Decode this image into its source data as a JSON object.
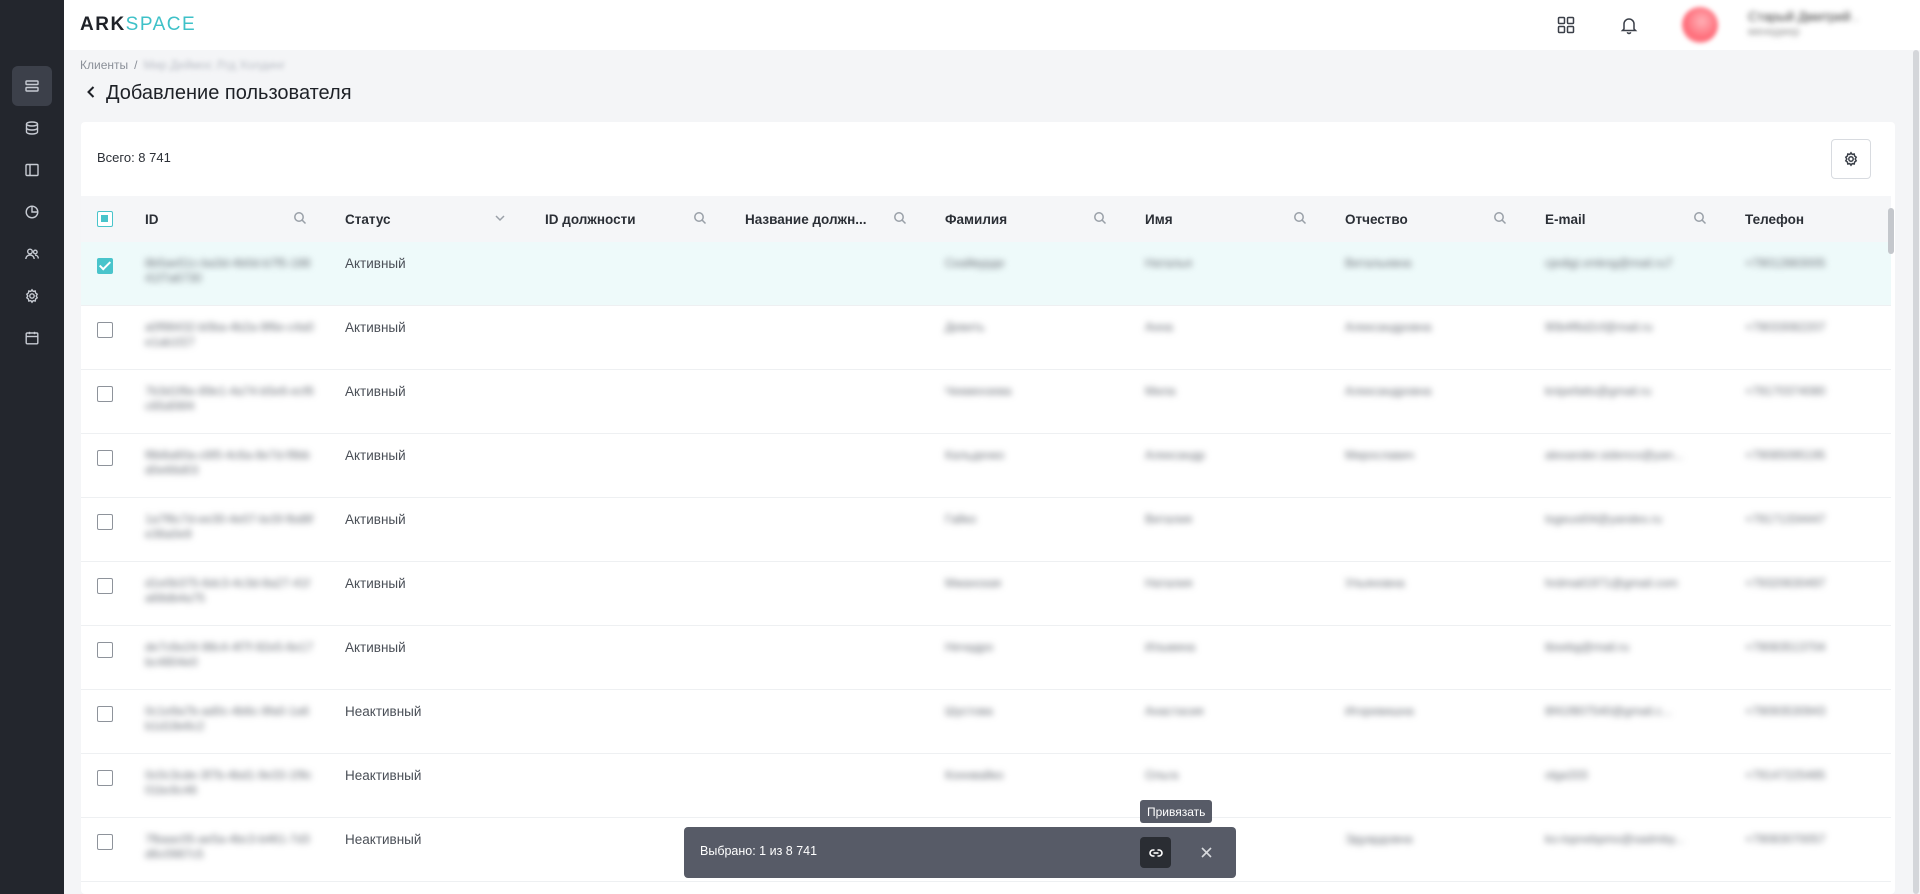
{
  "app": {
    "logo_part1": "ARK",
    "logo_part2": "SPACE"
  },
  "user": {
    "name": "Старый Дмитрий .",
    "role": "менеджер"
  },
  "breadcrumb": {
    "root": "Клиенты",
    "separator": "/",
    "current": "Мир Деймос Лтд Холдинг"
  },
  "page": {
    "title": "Добавление пользователя",
    "total": "Всего: 8 741"
  },
  "table": {
    "columns": [
      "ID",
      "Статус",
      "ID должности",
      "Название должн...",
      "Фамилия",
      "Имя",
      "Отчество",
      "E-mail",
      "Телефон"
    ],
    "rows": [
      {
        "id": "8b5ae51c-ba3d-4b0d-b7f5-18841f7a6730",
        "status": "Активный",
        "last": "Скайвурде",
        "first": "Наталья",
        "middle": "Витальевна",
        "email": "cjedigi.vmkng@mail.ru7",
        "phone": "+79012883005",
        "selected": true
      },
      {
        "id": "a0f98432-b0ba-4b2a-9f6e-c4a0e1ab1f27",
        "status": "Активный",
        "last": "Девить",
        "first": "Анна",
        "middle": "Александровна",
        "email": "90b4f6d2cf@mail.ru",
        "phone": "+79033082207",
        "selected": false
      },
      {
        "id": "7b3d1f6e-89e1-4a74-b5e6-ecf6c65d06f4",
        "status": "Активный",
        "last": "Чекмензева",
        "first": "Мила",
        "middle": "Александровна",
        "email": "knipefatts@gmail.ru",
        "phone": "+79170374080",
        "selected": false
      },
      {
        "id": "f8b8a60a-c6f0-4c6a-8e7d-f9bbd0e66d03",
        "status": "Активный",
        "last": "Кальденко",
        "first": "Александр",
        "middle": "Мирославич",
        "email": "alexander.sidenco@yan...",
        "phone": "+79085095195",
        "selected": false
      },
      {
        "id": "1a7f6c7d-ee30-4e07-bc5f-fbd8fe36a0e9",
        "status": "Активный",
        "last": "Гайко",
        "first": "Виталия",
        "middle": "",
        "email": "tsgeust04@yandex.ru",
        "phone": "+79171334447",
        "selected": false
      },
      {
        "id": "d1e0b375-6dc3-4c3d-8a27-41fa68db4a75",
        "status": "Активный",
        "last": "Мжанская",
        "first": "Наталия",
        "middle": "Ульяновна",
        "email": "hrdmail1971@gmail.com",
        "phone": "+79320630497",
        "selected": false
      },
      {
        "id": "de7c6e24-98c4-4f7f-92e5-6e17bc4804e0",
        "status": "Активный",
        "last": "Нечадро",
        "first": "Ильмина",
        "middle": "",
        "email": "tbsebg@mail.ru",
        "phone": "+79083513704",
        "selected": false
      },
      {
        "id": "0c1e9a7b-ad0c-4b6c-9fa0-1a6b1d18e6c2",
        "status": "Неактивный",
        "last": "Шустова",
        "first": "Анастасия",
        "middle": "Игоревишна",
        "email": "8f41f807540@gmail.c...",
        "phone": "+79093530943",
        "selected": false
      },
      {
        "id": "0c0c3cde-3f7b-4bd1-9e33-1f9c01bc6c46",
        "status": "Неактивный",
        "last": "Коннвайко",
        "first": "Ольга",
        "middle": "",
        "email": "olga333",
        "phone": "+79147225485",
        "selected": false
      },
      {
        "id": "7fbaac05-ae5a-4bc3-b461-7d3d6c0987c5",
        "status": "Неактивный",
        "last": "",
        "first": "",
        "middle": "Эдуардовна",
        "email": "ko-lopnebpmo@sadmby...",
        "phone": "+79083070057",
        "selected": false
      }
    ]
  },
  "selection_bar": {
    "text": "Выбрано: 1 из 8 741",
    "tooltip": "Привязать"
  },
  "icons": {
    "sidebar": [
      "list-icon",
      "database-icon",
      "layout-icon",
      "pie-chart-icon",
      "users-icon",
      "gear-icon",
      "calendar-icon"
    ],
    "top": [
      "apps-grid-icon",
      "bell-icon"
    ]
  },
  "colors": {
    "accent": "#49c4cb",
    "sidebar_bg": "#23262d",
    "selbar_bg": "#575b67"
  }
}
